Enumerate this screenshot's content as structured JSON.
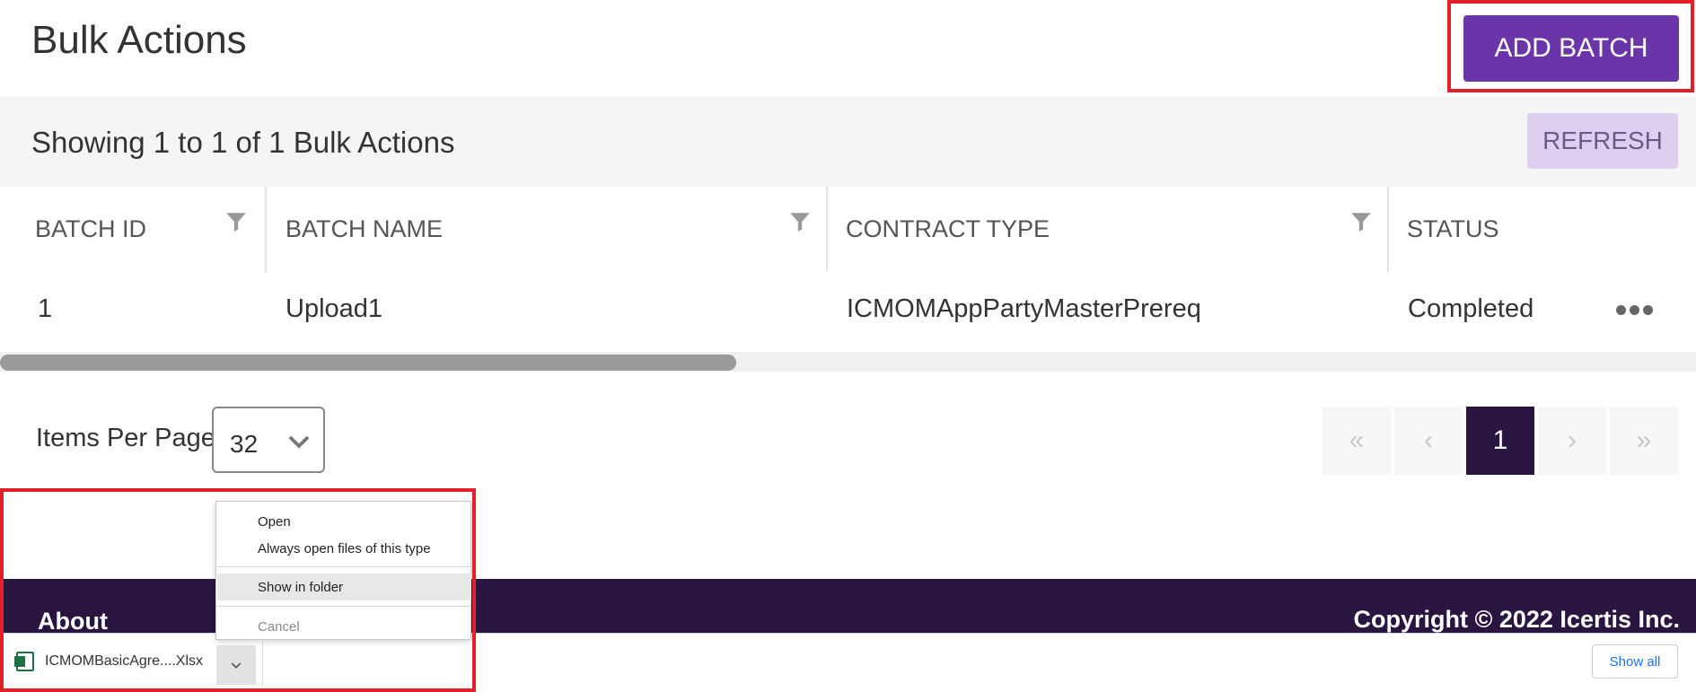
{
  "header": {
    "title": "Bulk Actions",
    "add_batch_label": "ADD BATCH"
  },
  "summary": {
    "text": "Showing 1 to 1 of 1 Bulk Actions",
    "refresh_label": "REFRESH"
  },
  "table": {
    "columns": [
      "BATCH ID",
      "BATCH NAME",
      "CONTRACT TYPE",
      "STATUS"
    ],
    "rows": [
      {
        "batch_id": "1",
        "batch_name": "Upload1",
        "contract_type": "ICMOMAppPartyMasterPrereq",
        "status": "Completed"
      }
    ]
  },
  "pagination": {
    "items_per_page_label": "Items Per Page",
    "items_per_page_value": "32",
    "current_page": "1",
    "first": "«",
    "prev": "‹",
    "next": "›",
    "last": "»"
  },
  "footer": {
    "about": "About",
    "copyright": "Copyright © 2022 Icertis Inc."
  },
  "download_bar": {
    "file_name": "ICMOMBasicAgre....Xlsx",
    "show_all_label": "Show all"
  },
  "context_menu": {
    "items": [
      "Open",
      "Always open files of this type",
      "Show in folder",
      "Cancel"
    ]
  },
  "colors": {
    "primary": "#6a35a8",
    "footer": "#2a1440",
    "highlight": "#e3202a",
    "refresh": "#dccff0"
  }
}
